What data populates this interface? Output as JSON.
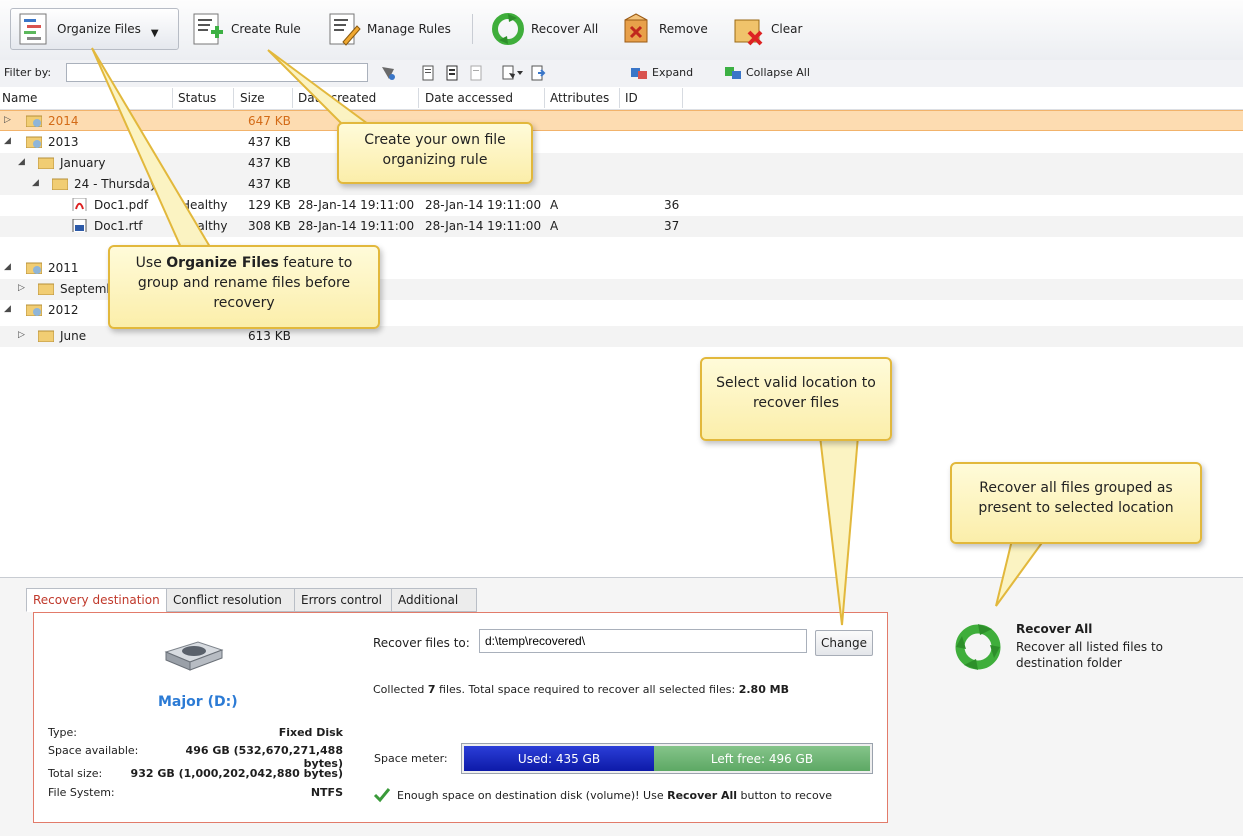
{
  "toolbar": {
    "organize_files": "Organize Files",
    "create_rule": "Create Rule",
    "manage_rules": "Manage Rules",
    "recover_all": "Recover All",
    "remove": "Remove",
    "clear": "Clear"
  },
  "filterbar": {
    "label": "Filter by:",
    "value": "",
    "expand": "Expand",
    "collapse_all": "Collapse All"
  },
  "columns": [
    "Name",
    "Status",
    "Size",
    "Date created",
    "Date accessed",
    "Attributes",
    "ID"
  ],
  "rows": [
    {
      "name": "2014",
      "size": "647 KB"
    },
    {
      "name": "2013",
      "size": "437 KB"
    },
    {
      "name": "January",
      "size": "437 KB"
    },
    {
      "name": "24 - Thursday",
      "size": "437 KB"
    },
    {
      "name": "Doc1.pdf",
      "status": "Healthy",
      "size": "129 KB",
      "created": "28-Jan-14 19:11:00",
      "accessed": "28-Jan-14 19:11:00",
      "attributes": "A",
      "id": "36"
    },
    {
      "name": "Doc1.rtf",
      "status": "Healthy",
      "size": "308 KB",
      "created": "28-Jan-14 19:11:00",
      "accessed": "28-Jan-14 19:11:00",
      "attributes": "A",
      "id": "37"
    },
    {
      "name": "2011",
      "size": ""
    },
    {
      "name": "September",
      "size": ""
    },
    {
      "name": "2012",
      "size": ""
    },
    {
      "name": "June",
      "size": "613 KB"
    }
  ],
  "callouts": {
    "create_rule": "Create your own file organizing rule",
    "organize_pre": "Use ",
    "organize_bold": "Organize Files",
    "organize_post": " feature to group and rename files before recovery",
    "select_location": "Select valid location to recover files",
    "recover_all": "Recover all files grouped as present to selected location"
  },
  "tabs": [
    "Recovery destination",
    "Conflict resolution",
    "Errors control",
    "Additional"
  ],
  "disk": {
    "name": "Major (D:)",
    "type_label": "Type:",
    "type_value": "Fixed Disk",
    "space_label": "Space available:",
    "space_value": "496 GB (532,670,271,488 bytes)",
    "total_label": "Total size:",
    "total_value": "932 GB (1,000,202,042,880 bytes)",
    "fs_label": "File System:",
    "fs_value": "NTFS"
  },
  "destination": {
    "label": "Recover files to:",
    "value": "d:\\temp\\recovered\\",
    "change": "Change",
    "collected_pre": "Collected ",
    "collected_count": "7",
    "collected_mid": " files. Total space required to recover all selected files: ",
    "collected_size": "2.80 MB",
    "meter_label": "Space meter:",
    "used": "Used: 435 GB",
    "free": "Left free: 496 GB",
    "used_fraction": 0.467,
    "ok_pre": "Enough space on destination disk (volume)! Use ",
    "ok_bold": "Recover All",
    "ok_post": " button to recove"
  },
  "recover_panel": {
    "title": "Recover All",
    "desc": "Recover all listed files to destination folder"
  }
}
